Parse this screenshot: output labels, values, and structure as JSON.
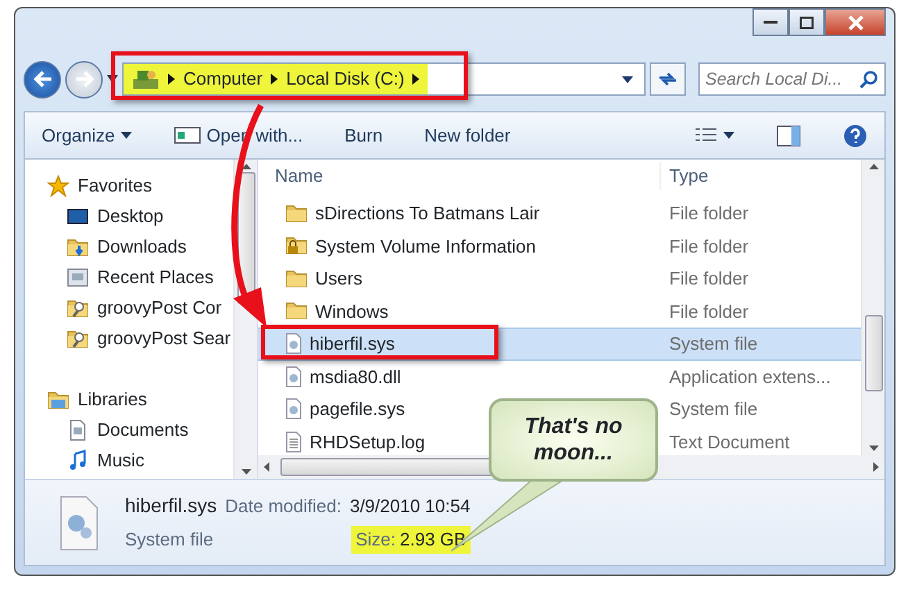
{
  "address": {
    "crumbs": [
      "Computer",
      "Local Disk (C:)"
    ]
  },
  "search": {
    "placeholder": "Search Local Di..."
  },
  "toolbar": [
    {
      "label": "Organize",
      "kind": "dropdown"
    },
    {
      "label": "Open with...",
      "kind": "icon"
    },
    {
      "label": "Burn",
      "kind": "plain"
    },
    {
      "label": "New folder",
      "kind": "plain"
    }
  ],
  "nav": [
    {
      "label": "Favorites",
      "kind": "star",
      "children": [
        {
          "label": "Desktop",
          "kind": "desktop"
        },
        {
          "label": "Downloads",
          "kind": "downloads"
        },
        {
          "label": "Recent Places",
          "kind": "recent"
        },
        {
          "label": "groovyPost Cor",
          "kind": "search"
        },
        {
          "label": "groovyPost Sear",
          "kind": "search"
        }
      ]
    },
    {
      "label": "Libraries",
      "kind": "library",
      "children": [
        {
          "label": "Documents",
          "kind": "document"
        },
        {
          "label": "Music",
          "kind": "music"
        }
      ]
    }
  ],
  "table": {
    "columns": [
      "Name",
      "Type"
    ],
    "rows": [
      {
        "name": "sDirections To Batmans Lair",
        "type": "File folder",
        "kind": "folder",
        "selected": false
      },
      {
        "name": "System Volume Information",
        "type": "File folder",
        "kind": "locked",
        "selected": false
      },
      {
        "name": "Users",
        "type": "File folder",
        "kind": "folder",
        "selected": false
      },
      {
        "name": "Windows",
        "type": "File folder",
        "kind": "folder",
        "selected": false
      },
      {
        "name": "hiberfil.sys",
        "type": "System file",
        "kind": "system",
        "selected": true
      },
      {
        "name": "msdia80.dll",
        "type": "Application extens...",
        "kind": "system",
        "selected": false
      },
      {
        "name": "pagefile.sys",
        "type": "System file",
        "kind": "system",
        "selected": false
      },
      {
        "name": "RHDSetup.log",
        "type": "Text Document",
        "kind": "text",
        "selected": false
      }
    ]
  },
  "details": {
    "name": "hiberfil.sys",
    "type": "System file",
    "date_label": "Date modified:",
    "date": "3/9/2010 10:54",
    "size_label": "Size:",
    "size": "2.93 GB"
  },
  "callout": {
    "text": "That's no moon..."
  }
}
